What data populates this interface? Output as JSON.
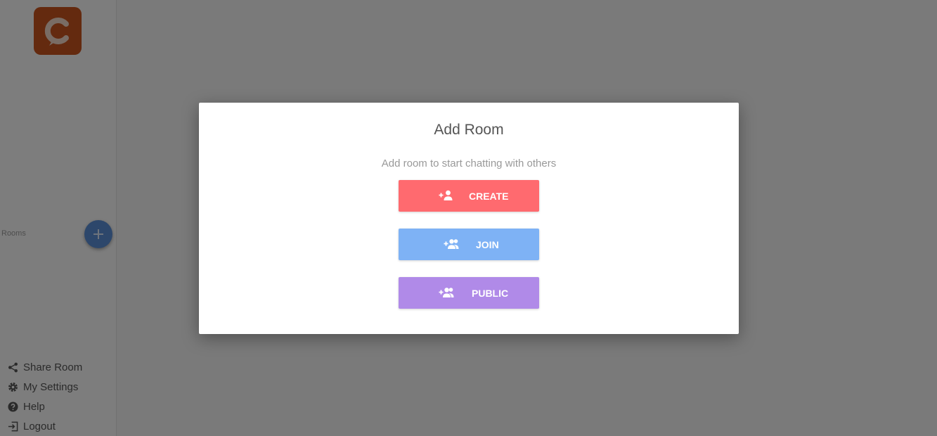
{
  "sidebar": {
    "logo_icon": "chat-c-logo",
    "rooms_label": "Rooms",
    "add_room_icon": "plus-icon",
    "menu": [
      {
        "label": "Share Room",
        "icon": "share-icon"
      },
      {
        "label": "My Settings",
        "icon": "gear-icon"
      },
      {
        "label": "Help",
        "icon": "help-icon"
      },
      {
        "label": "Logout",
        "icon": "logout-icon"
      }
    ]
  },
  "modal": {
    "title": "Add Room",
    "subtitle": "Add room to start chatting with others",
    "buttons": [
      {
        "label": "CREATE",
        "icon": "person-add-icon",
        "color": "#ff6a6f"
      },
      {
        "label": "JOIN",
        "icon": "group-add-icon",
        "color": "#7eb2f5"
      },
      {
        "label": "PUBLIC",
        "icon": "group-add-icon",
        "color": "#b08ae8"
      }
    ]
  },
  "colors": {
    "logo": "#c9551f",
    "fab": "#5b8ed6",
    "overlay": "rgba(0,0,0,0.5)"
  }
}
